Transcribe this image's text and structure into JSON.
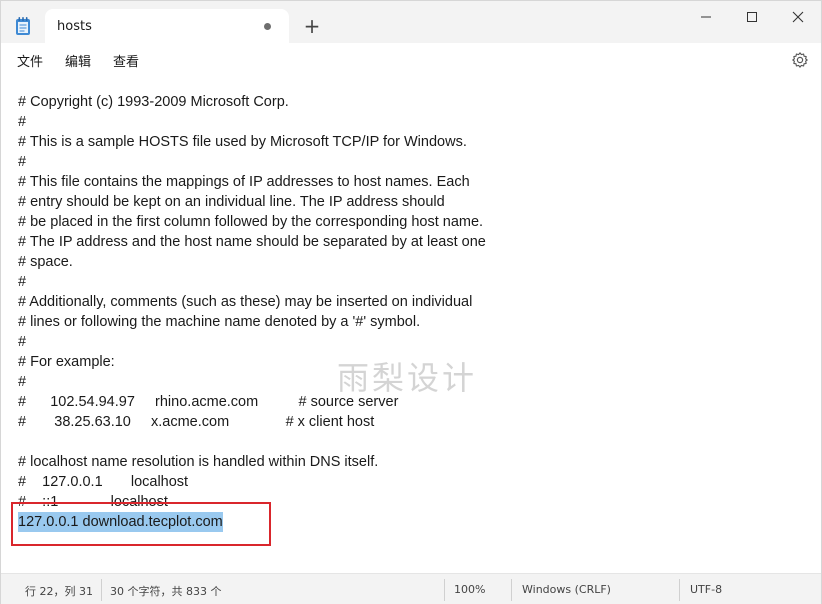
{
  "window": {
    "tab_title": "hosts",
    "new_tab_glyph": "+"
  },
  "menu": {
    "file": "文件",
    "edit": "编辑",
    "view": "查看"
  },
  "editor": {
    "lines": [
      "# Copyright (c) 1993-2009 Microsoft Corp.",
      "#",
      "# This is a sample HOSTS file used by Microsoft TCP/IP for Windows.",
      "#",
      "# This file contains the mappings of IP addresses to host names. Each",
      "# entry should be kept on an individual line. The IP address should",
      "# be placed in the first column followed by the corresponding host name.",
      "# The IP address and the host name should be separated by at least one",
      "# space.",
      "#",
      "# Additionally, comments (such as these) may be inserted on individual",
      "# lines or following the machine name denoted by a '#' symbol.",
      "#",
      "# For example:",
      "#",
      "#      102.54.94.97     rhino.acme.com          # source server",
      "#       38.25.63.10     x.acme.com              # x client host",
      "",
      "# localhost name resolution is handled within DNS itself.",
      "#\t127.0.0.1       localhost",
      "#\t::1             localhost",
      "127.0.0.1 download.tecplot.com"
    ],
    "selected_line_index": 21,
    "watermark": "雨梨设计"
  },
  "status": {
    "position": "行 22，列 31",
    "chars": "30 个字符，共 833 个",
    "zoom": "100%",
    "line_ending": "Windows (CRLF)",
    "encoding": "UTF-8"
  },
  "colors": {
    "selection": "#99c9ef",
    "annotation_box": "#d9262c"
  },
  "icons": {
    "app": "notepad-icon",
    "tab_modified": "dot-icon",
    "minimize": "minimize-icon",
    "maximize": "maximize-icon",
    "close": "close-icon",
    "settings": "gear-icon"
  }
}
